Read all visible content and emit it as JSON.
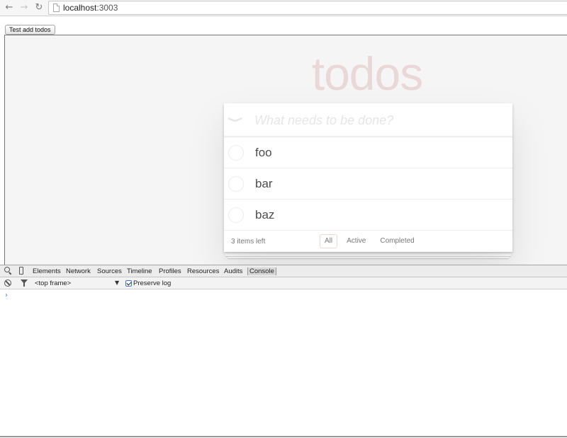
{
  "browser": {
    "back_icon": "←",
    "forward_icon": "→",
    "reload_icon": "↻",
    "url_host": "localhost",
    "url_port": ":3003"
  },
  "page": {
    "test_button_label": "Test add todos"
  },
  "todo": {
    "title": "todos",
    "toggle_all_glyph": "❯",
    "placeholder": "What needs to be done?",
    "items": [
      {
        "label": "foo",
        "completed": false
      },
      {
        "label": "bar",
        "completed": false
      },
      {
        "label": "baz",
        "completed": false
      }
    ],
    "items_left": "3 items left",
    "filters": [
      "All",
      "Active",
      "Completed"
    ],
    "selected_filter": "All"
  },
  "devtools": {
    "tabs": [
      "Elements",
      "Network",
      "Sources",
      "Timeline",
      "Profiles",
      "Resources",
      "Audits",
      "Console"
    ],
    "active_tab": "Console",
    "frame_selector": "<top frame>",
    "frame_arrow": "▼",
    "preserve_log_label": "Preserve log",
    "preserve_log_checked": true,
    "prompt": "›"
  },
  "colors": {
    "title_color": "#e9d3d3",
    "accent_blue": "#3b7ae0"
  }
}
